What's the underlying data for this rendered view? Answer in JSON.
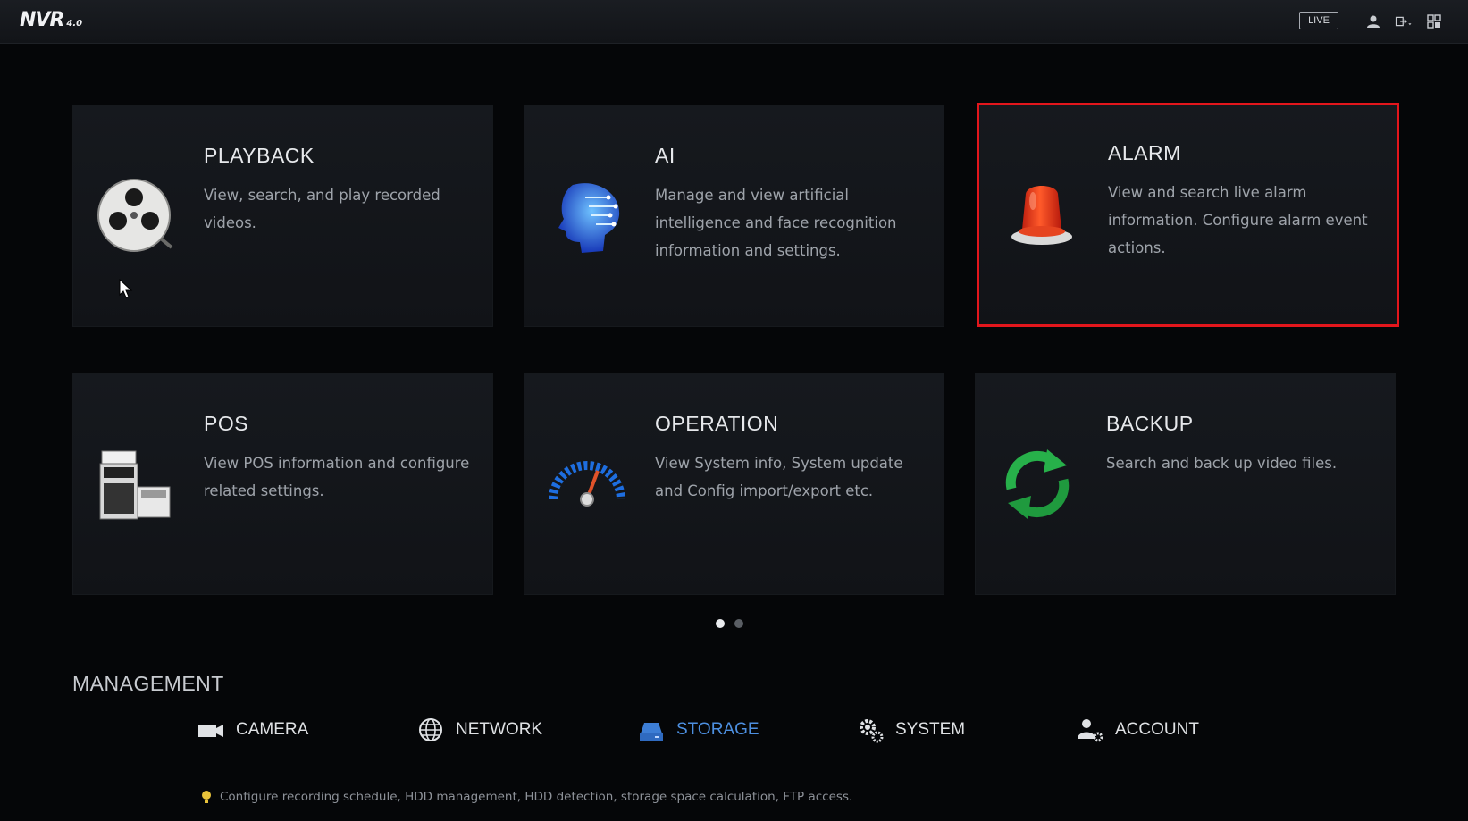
{
  "topbar": {
    "logo_text": "NVR",
    "logo_version": "4.0",
    "live_label": "LIVE",
    "icons": [
      "user-icon",
      "logout-icon",
      "grid-menu-icon"
    ]
  },
  "cards": [
    {
      "title": "PLAYBACK",
      "description": "View, search, and play recorded videos.",
      "icon": "film-reel-icon"
    },
    {
      "title": "AI",
      "description": "Manage and view artificial intelligence and face recognition information and settings.",
      "icon": "ai-head-icon"
    },
    {
      "title": "ALARM",
      "description": "View and search live alarm information. Configure alarm event actions.",
      "icon": "alarm-siren-icon",
      "selected": true
    },
    {
      "title": "POS",
      "description": "View POS information and configure related settings.",
      "icon": "cash-register-icon"
    },
    {
      "title": "OPERATION",
      "description": "View System info, System update and Config import/export etc.",
      "icon": "gauge-icon"
    },
    {
      "title": "BACKUP",
      "description": "Search and back up video files.",
      "icon": "sync-arrows-icon"
    }
  ],
  "pager": {
    "pages": 2,
    "current": 1
  },
  "management": {
    "title": "MANAGEMENT",
    "items": [
      {
        "label": "CAMERA",
        "icon": "camera-icon"
      },
      {
        "label": "NETWORK",
        "icon": "globe-icon"
      },
      {
        "label": "STORAGE",
        "icon": "hdd-icon",
        "active": true
      },
      {
        "label": "SYSTEM",
        "icon": "gears-icon"
      },
      {
        "label": "ACCOUNT",
        "icon": "user-gear-icon"
      }
    ],
    "hint": "Configure recording schedule, HDD management, HDD detection, storage space calculation, FTP access."
  },
  "colors": {
    "selected_border": "#e3161c",
    "active_item": "#4d8fe0",
    "background": "#050608"
  }
}
